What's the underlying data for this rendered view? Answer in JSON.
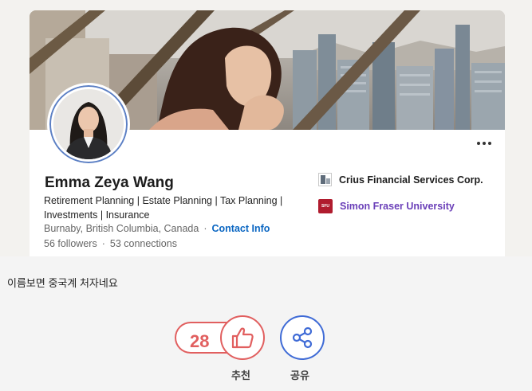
{
  "profile": {
    "name": "Emma Zeya Wang",
    "headline": "Retirement Planning | Estate Planning | Tax Planning | Investments | Insurance",
    "location": "Burnaby, British Columbia, Canada",
    "location_separator": "·",
    "contact_link": "Contact Info",
    "followers": "56 followers",
    "connections_separator": "·",
    "connections": "53 connections",
    "company": "Crius Financial Services Corp.",
    "school": "Simon Fraser University",
    "school_logo_text": "SFU"
  },
  "post": {
    "text": "이름보면 중국계 처자네요"
  },
  "actions": {
    "recommend_count": "28",
    "recommend_label": "추천",
    "share_label": "공유"
  },
  "colors": {
    "link": "#0a66c2",
    "school": "#6a3fb8",
    "recommend": "#e15f5f",
    "share": "#3f6bd6"
  },
  "icons": [
    "more-icon",
    "thumbs-up-icon",
    "share-icon",
    "company-logo-icon",
    "school-logo-icon"
  ]
}
